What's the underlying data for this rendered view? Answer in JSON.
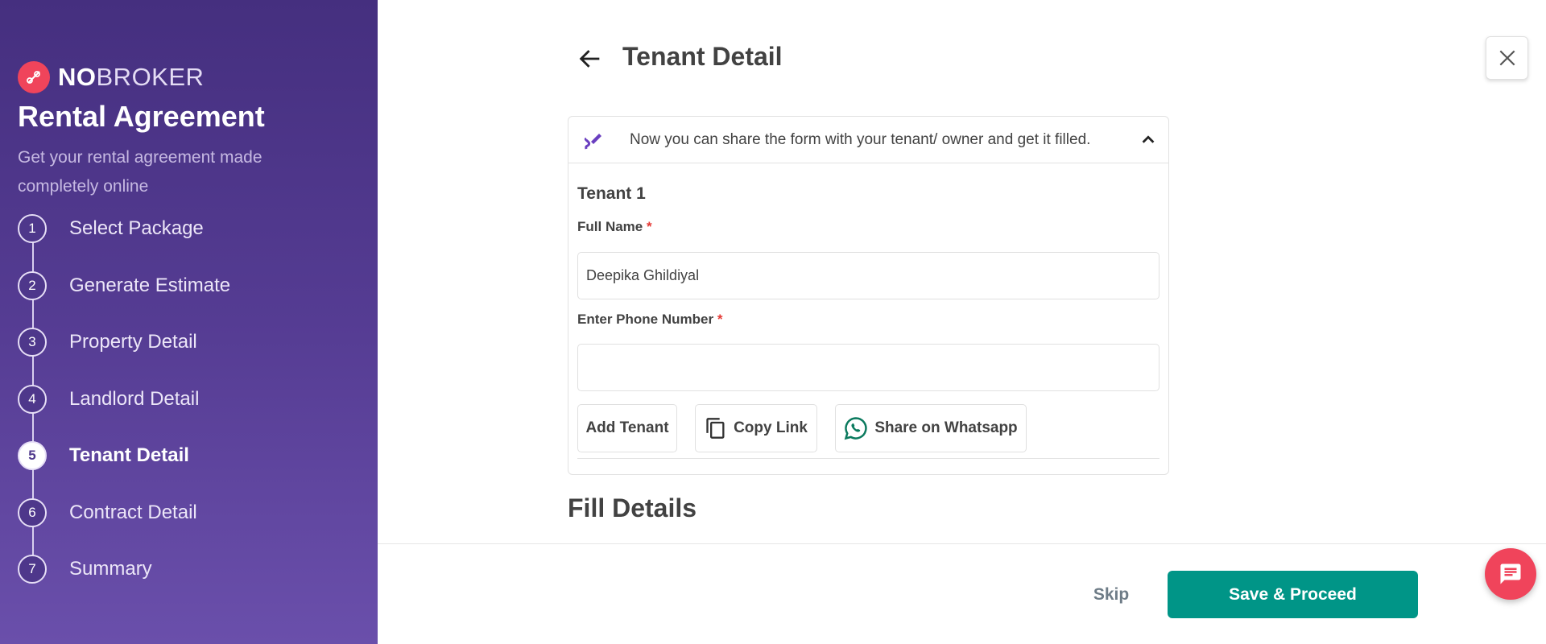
{
  "sidebar": {
    "logo": {
      "bold": "NO",
      "light": "BROKER"
    },
    "title": "Rental Agreement",
    "subtitle": "Get your rental agreement made completely online",
    "steps": [
      {
        "num": "1",
        "label": "Select Package"
      },
      {
        "num": "2",
        "label": "Generate Estimate"
      },
      {
        "num": "3",
        "label": "Property Detail"
      },
      {
        "num": "4",
        "label": "Landlord Detail"
      },
      {
        "num": "5",
        "label": "Tenant Detail",
        "active": true
      },
      {
        "num": "6",
        "label": "Contract Detail"
      },
      {
        "num": "7",
        "label": "Summary"
      }
    ]
  },
  "header": {
    "title": "Tenant Detail"
  },
  "share_card": {
    "message": "Now you can share the form with your tenant/ owner and get it filled.",
    "tenant_label": "Tenant 1",
    "full_name_label": "Full Name",
    "full_name_value": "Deepika Ghildiyal",
    "phone_label": "Enter Phone Number",
    "phone_value": "",
    "required_mark": "*",
    "add_tenant": "Add Tenant",
    "copy_link": "Copy Link",
    "share_whatsapp": "Share on Whatsapp"
  },
  "section_title": "Fill Details",
  "footer": {
    "skip": "Skip",
    "save": "Save & Proceed"
  },
  "colors": {
    "primary": "#009587",
    "brand": "#f0445b",
    "sidebar": "#4e378b"
  }
}
